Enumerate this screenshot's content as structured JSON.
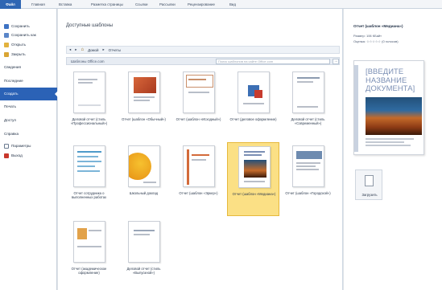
{
  "ribbon": {
    "tabs": [
      "Файл",
      "Главная",
      "Вставка",
      "Разметка страницы",
      "Ссылки",
      "Рассылки",
      "Рецензирование",
      "Вид"
    ]
  },
  "nav": {
    "items": [
      {
        "label": "Сохранить",
        "icon": "save-icon"
      },
      {
        "label": "Сохранить как",
        "icon": "save-as-icon"
      },
      {
        "label": "Открыть",
        "icon": "open-folder-icon"
      },
      {
        "label": "Закрыть",
        "icon": "close-doc-icon"
      },
      {
        "label": "Сведения"
      },
      {
        "label": "Последние"
      },
      {
        "label": "Создать"
      },
      {
        "label": "Печать"
      },
      {
        "label": "Доступ"
      },
      {
        "label": "Справка"
      },
      {
        "label": "Параметры",
        "icon": "options-icon"
      },
      {
        "label": "Выход",
        "icon": "exit-icon"
      }
    ]
  },
  "main": {
    "title": "Доступные шаблоны",
    "breadcrumb": {
      "back": "◂",
      "forward": "▸",
      "home_icon": "home-icon",
      "home": "Домой",
      "current": "Отчеты"
    },
    "source_label": "Шаблоны Office.com",
    "search_placeholder": "Поиск шаблонов на сайте Office.com",
    "search_button": "→",
    "templates": [
      {
        "caption": "Деловой отчет (стиль «Профессиональный»)"
      },
      {
        "caption": "Отчет (шаблон «Обычный»)"
      },
      {
        "caption": "Отчет (шаблон «Исходный»)"
      },
      {
        "caption": "Отчет (деловое оформление)"
      },
      {
        "caption": "Деловой отчет (стиль «Современный»)"
      },
      {
        "caption": "Отчет сотрудника о выполненных работах"
      },
      {
        "caption": "Школьный доклад"
      },
      {
        "caption": "Отчет (шаблон «Эркер»)"
      },
      {
        "caption": "Отчет (шаблон «Медиана»)"
      },
      {
        "caption": "Отчет (шаблон «Городской»)"
      },
      {
        "caption": "Отчет (академическое оформление)"
      },
      {
        "caption": "Деловой отчет (стиль «Выпускной»)"
      }
    ]
  },
  "preview": {
    "title": "Отчет (шаблон «Медиана»)",
    "size": "Размер: 106 КБайт",
    "rating": "Оценка: ☆☆☆☆☆ (0 голосов)",
    "heading": "[ВВЕДИТЕ НАЗВАНИЕ ДОКУМЕНТА]",
    "download_label": "Загрузить"
  },
  "colors": {
    "accent": "#2b62b6",
    "selected": "#fbe085",
    "selected_border": "#e6b93c"
  }
}
